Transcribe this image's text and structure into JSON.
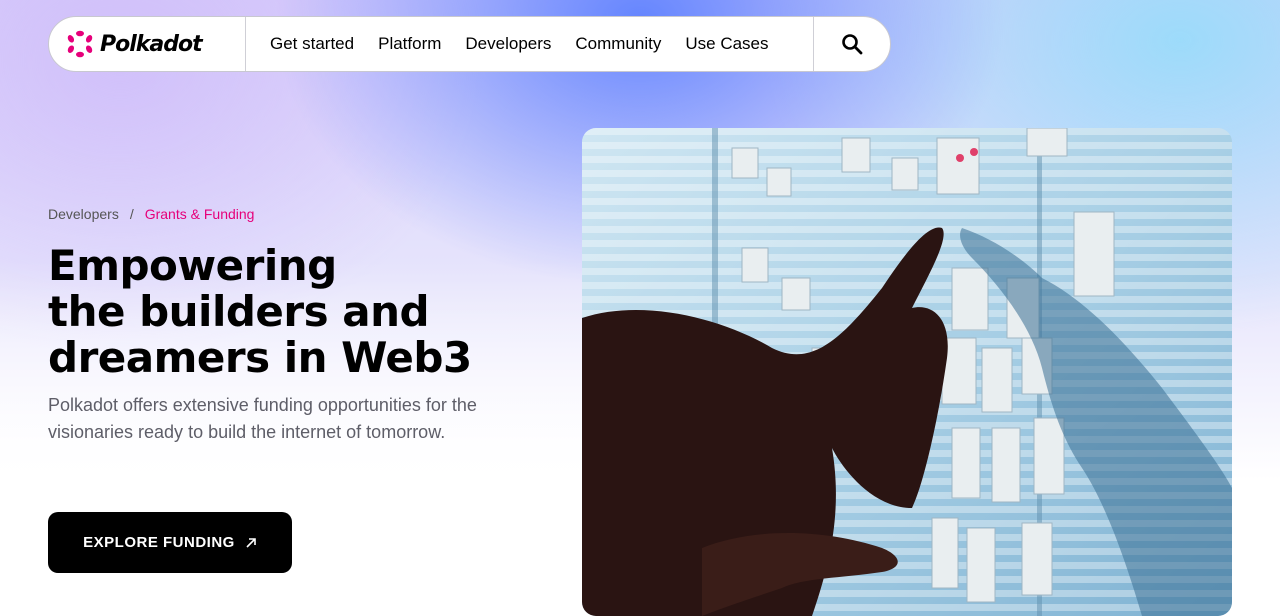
{
  "brand": {
    "name": "Polkadot",
    "accent_color": "#e6007a",
    "logo_icon": "polkadot-logo-icon"
  },
  "nav": {
    "items": [
      {
        "label": "Get started"
      },
      {
        "label": "Platform"
      },
      {
        "label": "Developers"
      },
      {
        "label": "Community"
      },
      {
        "label": "Use Cases"
      }
    ],
    "search_icon": "search-icon"
  },
  "breadcrumb": {
    "items": [
      "Developers",
      "Grants & Funding"
    ],
    "separator": "/"
  },
  "hero": {
    "title_lines": [
      "Empowering",
      "the builders and",
      "dreamers in Web3"
    ],
    "description": "Polkadot offers extensive funding opportunities for the visionaries ready to build the internet of tomorrow.",
    "cta_label": "EXPLORE FUNDING",
    "cta_icon": "arrow-up-right-icon",
    "image": "photo of people pointing at sticky notes on a glass wall"
  }
}
